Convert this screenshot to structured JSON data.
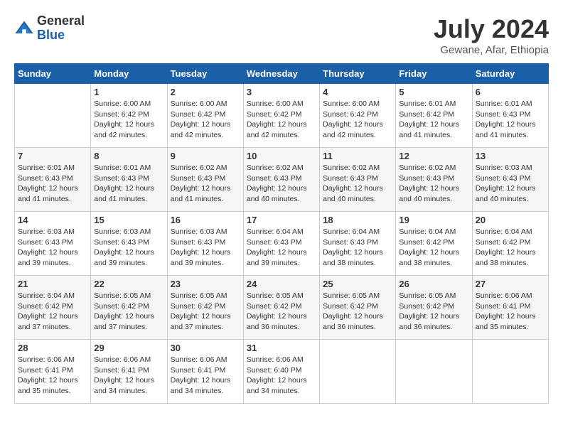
{
  "logo": {
    "general": "General",
    "blue": "Blue"
  },
  "title": "July 2024",
  "subtitle": "Gewane, Afar, Ethiopia",
  "days_of_week": [
    "Sunday",
    "Monday",
    "Tuesday",
    "Wednesday",
    "Thursday",
    "Friday",
    "Saturday"
  ],
  "weeks": [
    [
      {
        "day": "",
        "info": ""
      },
      {
        "day": "1",
        "info": "Sunrise: 6:00 AM\nSunset: 6:42 PM\nDaylight: 12 hours\nand 42 minutes."
      },
      {
        "day": "2",
        "info": "Sunrise: 6:00 AM\nSunset: 6:42 PM\nDaylight: 12 hours\nand 42 minutes."
      },
      {
        "day": "3",
        "info": "Sunrise: 6:00 AM\nSunset: 6:42 PM\nDaylight: 12 hours\nand 42 minutes."
      },
      {
        "day": "4",
        "info": "Sunrise: 6:00 AM\nSunset: 6:42 PM\nDaylight: 12 hours\nand 42 minutes."
      },
      {
        "day": "5",
        "info": "Sunrise: 6:01 AM\nSunset: 6:42 PM\nDaylight: 12 hours\nand 41 minutes."
      },
      {
        "day": "6",
        "info": "Sunrise: 6:01 AM\nSunset: 6:43 PM\nDaylight: 12 hours\nand 41 minutes."
      }
    ],
    [
      {
        "day": "7",
        "info": "Sunrise: 6:01 AM\nSunset: 6:43 PM\nDaylight: 12 hours\nand 41 minutes."
      },
      {
        "day": "8",
        "info": "Sunrise: 6:01 AM\nSunset: 6:43 PM\nDaylight: 12 hours\nand 41 minutes."
      },
      {
        "day": "9",
        "info": "Sunrise: 6:02 AM\nSunset: 6:43 PM\nDaylight: 12 hours\nand 41 minutes."
      },
      {
        "day": "10",
        "info": "Sunrise: 6:02 AM\nSunset: 6:43 PM\nDaylight: 12 hours\nand 40 minutes."
      },
      {
        "day": "11",
        "info": "Sunrise: 6:02 AM\nSunset: 6:43 PM\nDaylight: 12 hours\nand 40 minutes."
      },
      {
        "day": "12",
        "info": "Sunrise: 6:02 AM\nSunset: 6:43 PM\nDaylight: 12 hours\nand 40 minutes."
      },
      {
        "day": "13",
        "info": "Sunrise: 6:03 AM\nSunset: 6:43 PM\nDaylight: 12 hours\nand 40 minutes."
      }
    ],
    [
      {
        "day": "14",
        "info": "Sunrise: 6:03 AM\nSunset: 6:43 PM\nDaylight: 12 hours\nand 39 minutes."
      },
      {
        "day": "15",
        "info": "Sunrise: 6:03 AM\nSunset: 6:43 PM\nDaylight: 12 hours\nand 39 minutes."
      },
      {
        "day": "16",
        "info": "Sunrise: 6:03 AM\nSunset: 6:43 PM\nDaylight: 12 hours\nand 39 minutes."
      },
      {
        "day": "17",
        "info": "Sunrise: 6:04 AM\nSunset: 6:43 PM\nDaylight: 12 hours\nand 39 minutes."
      },
      {
        "day": "18",
        "info": "Sunrise: 6:04 AM\nSunset: 6:43 PM\nDaylight: 12 hours\nand 38 minutes."
      },
      {
        "day": "19",
        "info": "Sunrise: 6:04 AM\nSunset: 6:42 PM\nDaylight: 12 hours\nand 38 minutes."
      },
      {
        "day": "20",
        "info": "Sunrise: 6:04 AM\nSunset: 6:42 PM\nDaylight: 12 hours\nand 38 minutes."
      }
    ],
    [
      {
        "day": "21",
        "info": "Sunrise: 6:04 AM\nSunset: 6:42 PM\nDaylight: 12 hours\nand 37 minutes."
      },
      {
        "day": "22",
        "info": "Sunrise: 6:05 AM\nSunset: 6:42 PM\nDaylight: 12 hours\nand 37 minutes."
      },
      {
        "day": "23",
        "info": "Sunrise: 6:05 AM\nSunset: 6:42 PM\nDaylight: 12 hours\nand 37 minutes."
      },
      {
        "day": "24",
        "info": "Sunrise: 6:05 AM\nSunset: 6:42 PM\nDaylight: 12 hours\nand 36 minutes."
      },
      {
        "day": "25",
        "info": "Sunrise: 6:05 AM\nSunset: 6:42 PM\nDaylight: 12 hours\nand 36 minutes."
      },
      {
        "day": "26",
        "info": "Sunrise: 6:05 AM\nSunset: 6:42 PM\nDaylight: 12 hours\nand 36 minutes."
      },
      {
        "day": "27",
        "info": "Sunrise: 6:06 AM\nSunset: 6:41 PM\nDaylight: 12 hours\nand 35 minutes."
      }
    ],
    [
      {
        "day": "28",
        "info": "Sunrise: 6:06 AM\nSunset: 6:41 PM\nDaylight: 12 hours\nand 35 minutes."
      },
      {
        "day": "29",
        "info": "Sunrise: 6:06 AM\nSunset: 6:41 PM\nDaylight: 12 hours\nand 34 minutes."
      },
      {
        "day": "30",
        "info": "Sunrise: 6:06 AM\nSunset: 6:41 PM\nDaylight: 12 hours\nand 34 minutes."
      },
      {
        "day": "31",
        "info": "Sunrise: 6:06 AM\nSunset: 6:40 PM\nDaylight: 12 hours\nand 34 minutes."
      },
      {
        "day": "",
        "info": ""
      },
      {
        "day": "",
        "info": ""
      },
      {
        "day": "",
        "info": ""
      }
    ]
  ]
}
